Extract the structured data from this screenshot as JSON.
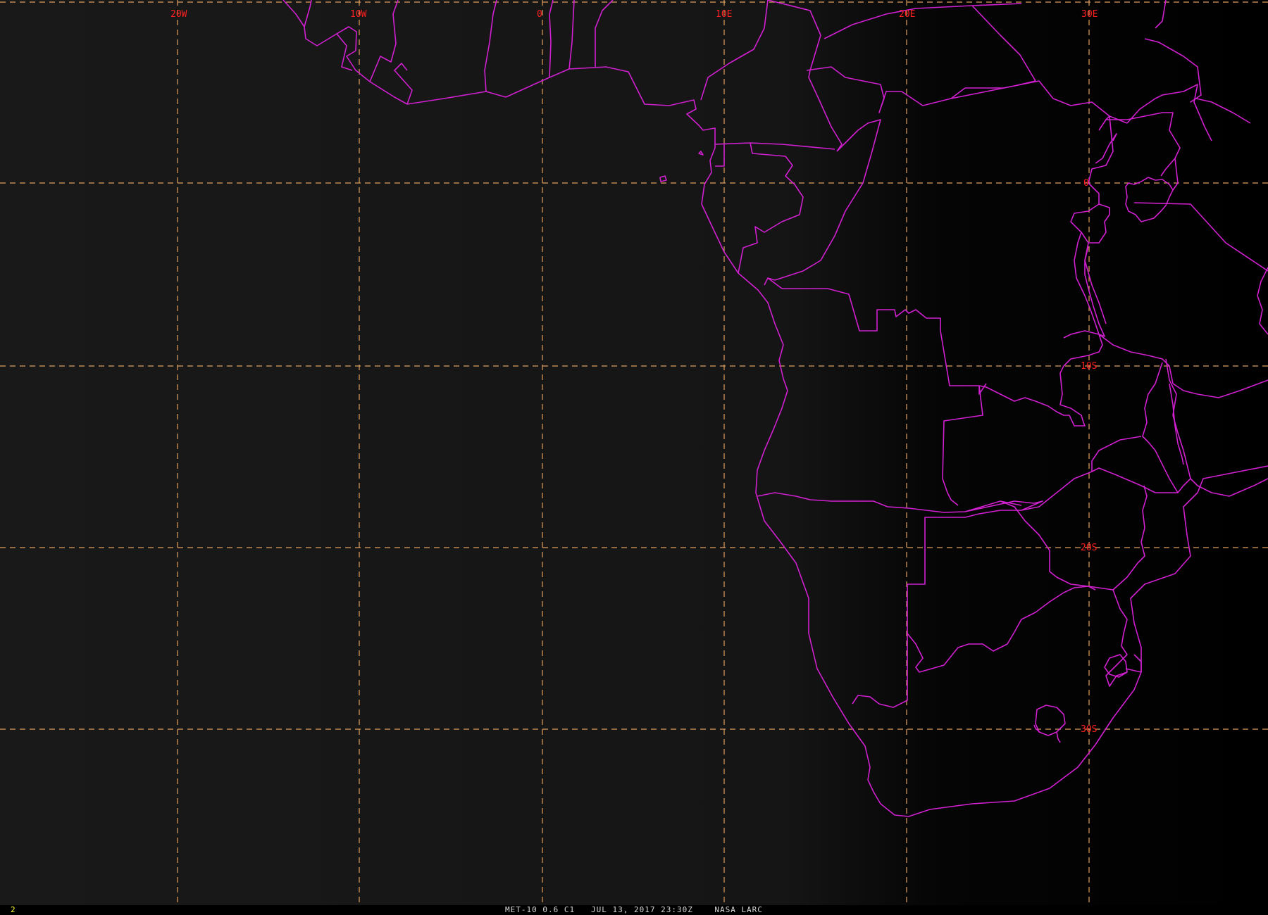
{
  "map": {
    "background_colors": {
      "sunlit_ocean": "#191919",
      "night_side": "#000000"
    },
    "gridline_color": "#e0a060",
    "border_color": "#d020d0",
    "label_color": "#ff2020",
    "lon_labels": [
      "20W",
      "10W",
      "0",
      "10E",
      "20E",
      "30E"
    ],
    "lat_labels": [
      "0",
      "10S",
      "20S",
      "30S"
    ]
  },
  "status_bar": {
    "frame_number": "2",
    "frame_color": "#ffff40",
    "caption": "MET-10 0.6 C1   JUL 13, 2017 23:30Z    NASA LARC"
  }
}
